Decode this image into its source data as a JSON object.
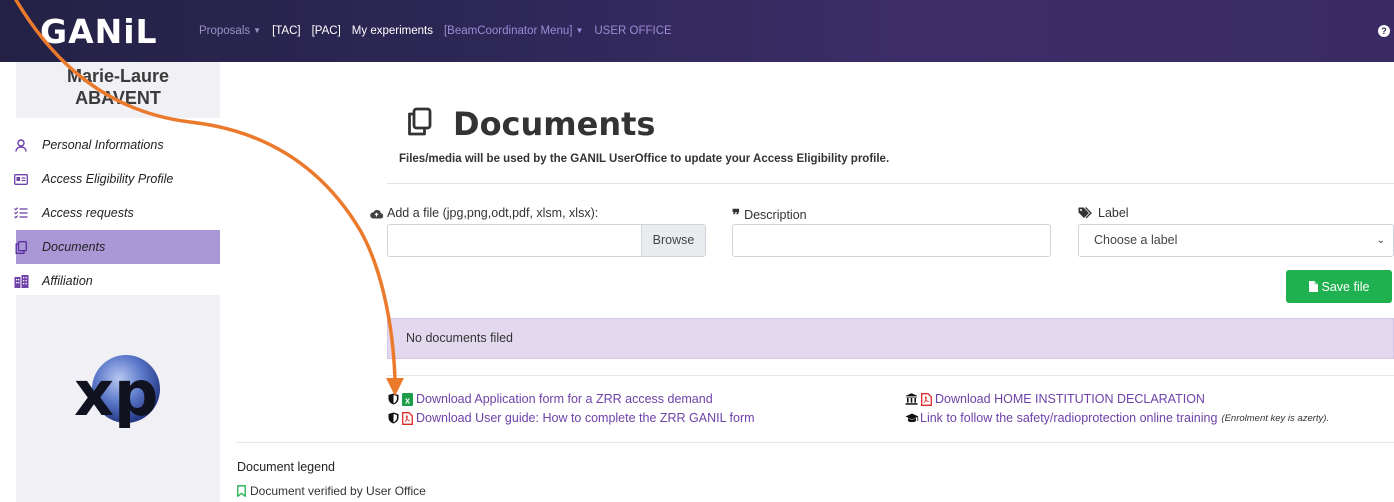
{
  "app": {
    "logo_text": "GANiL",
    "accent_color": "#a997d6",
    "header_color": "#2d2756"
  },
  "navbar": {
    "items": [
      {
        "label": "Proposals",
        "has_caret": true
      },
      {
        "label": "[TAC]"
      },
      {
        "label": "[PAC]"
      },
      {
        "label": "My experiments"
      },
      {
        "label": "[BeamCoordinator Menu]",
        "has_caret": true
      },
      {
        "label": "USER OFFICE"
      }
    ],
    "help_icon": "question-circle-icon"
  },
  "sidebar": {
    "user_first": "Marie-Laure",
    "user_last": "ABAVENT",
    "items": [
      {
        "label": "Personal Informations",
        "icon": "user-icon"
      },
      {
        "label": "Access Eligibility Profile",
        "icon": "id-card-icon"
      },
      {
        "label": "Access requests",
        "icon": "checklist-icon"
      },
      {
        "label": "Documents",
        "icon": "copy-icon",
        "active": true
      },
      {
        "label": "Affiliation",
        "icon": "building-icon"
      }
    ],
    "logo_text": "xp"
  },
  "main": {
    "title": "Documents",
    "subtitle": "Files/media will be used by the GANIL UserOffice to update your Access Eligibility profile.",
    "form": {
      "file_label": "Add a file (jpg,png,odt,pdf, xlsm, xlsx):",
      "browse_label": "Browse",
      "description_label": "Description",
      "description_value": "",
      "label_label": "Label",
      "label_selected": "Choose a label",
      "save_label": "Save file"
    },
    "no_documents": "No documents filed",
    "downloads_left": [
      {
        "text": "Download Application form for a ZRR access demand",
        "file_icon": "excel-icon"
      },
      {
        "text": "Download User guide: How to complete the ZRR GANIL form",
        "file_icon": "pdf-icon"
      }
    ],
    "downloads_right": [
      {
        "text": "Download HOME INSTITUTION DECLARATION",
        "file_icon": "pdf-icon"
      },
      {
        "text": "Link to follow the safety/radioprotection online training",
        "note": "(Enrolment key is azerty)."
      }
    ],
    "legend": {
      "title": "Document legend",
      "items": [
        {
          "text": "Document verified by User Office",
          "icon": "bookmark-icon",
          "color": "#1fb14f"
        }
      ]
    }
  }
}
